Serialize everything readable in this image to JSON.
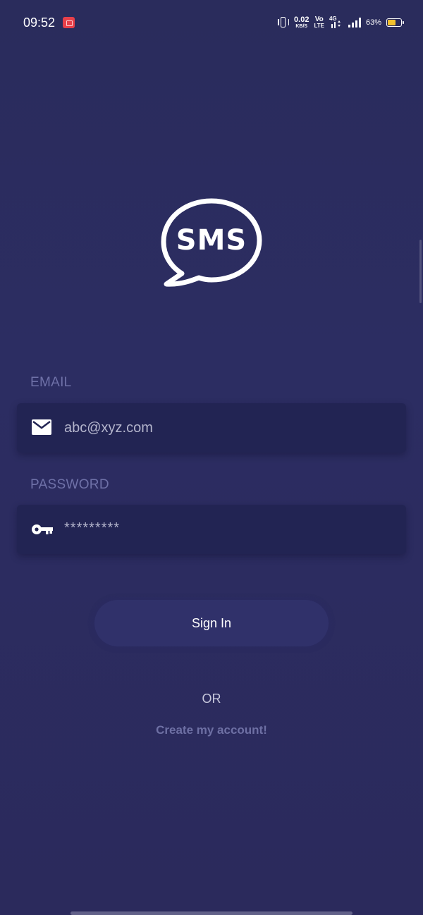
{
  "status_bar": {
    "time": "09:52",
    "net_speed_value": "0.02",
    "net_speed_unit": "KB/S",
    "volte_top": "Vo",
    "volte_bottom": "LTE",
    "network_type": "4G",
    "battery_percent": "63%",
    "battery_level": 0.63,
    "battery_color": "#f2c12e",
    "icons": [
      "recording-icon",
      "vibrate-icon",
      "signal-4g-icon",
      "signal-bars-icon",
      "battery-icon"
    ]
  },
  "logo": {
    "text": "SMS",
    "icon": "speech-bubble-icon"
  },
  "form": {
    "email_label": "EMAIL",
    "email_value": "abc@xyz.com",
    "email_icon": "mail-icon",
    "password_label": "PASSWORD",
    "password_value": "*********",
    "password_icon": "key-icon"
  },
  "actions": {
    "sign_in_label": "Sign In",
    "or_text": "OR",
    "create_account_label": "Create my account!"
  },
  "colors": {
    "background": "#2b2c5e",
    "field_background": "#222453",
    "label": "#6f71a8",
    "button_background": "#30316a",
    "link": "#6e70a4"
  }
}
